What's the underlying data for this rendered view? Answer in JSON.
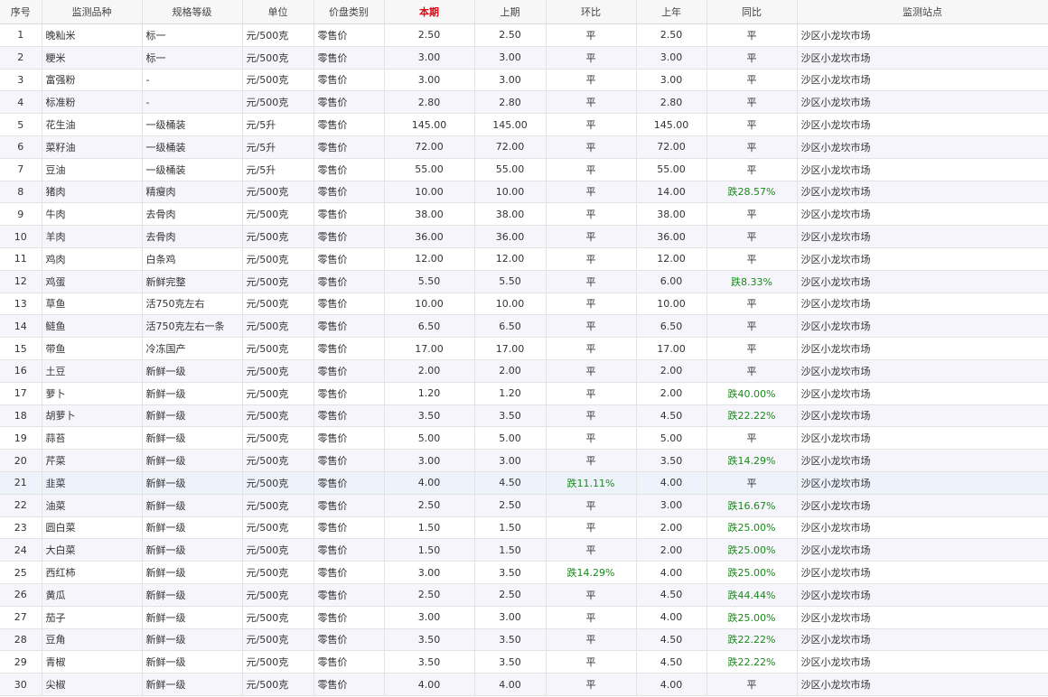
{
  "colors": {
    "current_period_header": "#e60012",
    "fall_text": "#1a8a1a",
    "even_row": "#f6f5fb",
    "header_bg": "#f7f7f7"
  },
  "columns": [
    {
      "key": "no",
      "label": "序号",
      "align": "c"
    },
    {
      "key": "item",
      "label": "监测品种",
      "align": "l"
    },
    {
      "key": "spec",
      "label": "规格等级",
      "align": "l"
    },
    {
      "key": "unit",
      "label": "单位",
      "align": "l"
    },
    {
      "key": "ptype",
      "label": "价盘类别",
      "align": "l"
    },
    {
      "key": "cur",
      "label": "本期",
      "align": "c",
      "highlight": true
    },
    {
      "key": "prev",
      "label": "上期",
      "align": "c"
    },
    {
      "key": "mom",
      "label": "环比",
      "align": "c"
    },
    {
      "key": "ly",
      "label": "上年",
      "align": "c"
    },
    {
      "key": "yoy",
      "label": "同比",
      "align": "c"
    },
    {
      "key": "site",
      "label": "监测站点",
      "align": "l"
    }
  ],
  "rows": [
    {
      "no": "1",
      "item": "晚籼米",
      "spec": "标一",
      "unit": "元/500克",
      "ptype": "零售价",
      "cur": "2.50",
      "prev": "2.50",
      "mom": "平",
      "ly": "2.50",
      "yoy": "平",
      "site": "沙区小龙坎市场"
    },
    {
      "no": "2",
      "item": "粳米",
      "spec": "标一",
      "unit": "元/500克",
      "ptype": "零售价",
      "cur": "3.00",
      "prev": "3.00",
      "mom": "平",
      "ly": "3.00",
      "yoy": "平",
      "site": "沙区小龙坎市场"
    },
    {
      "no": "3",
      "item": "富强粉",
      "spec": "-",
      "unit": "元/500克",
      "ptype": "零售价",
      "cur": "3.00",
      "prev": "3.00",
      "mom": "平",
      "ly": "3.00",
      "yoy": "平",
      "site": "沙区小龙坎市场"
    },
    {
      "no": "4",
      "item": "标准粉",
      "spec": "-",
      "unit": "元/500克",
      "ptype": "零售价",
      "cur": "2.80",
      "prev": "2.80",
      "mom": "平",
      "ly": "2.80",
      "yoy": "平",
      "site": "沙区小龙坎市场"
    },
    {
      "no": "5",
      "item": "花生油",
      "spec": "一级桶装",
      "unit": "元/5升",
      "ptype": "零售价",
      "cur": "145.00",
      "prev": "145.00",
      "mom": "平",
      "ly": "145.00",
      "yoy": "平",
      "site": "沙区小龙坎市场"
    },
    {
      "no": "6",
      "item": "菜籽油",
      "spec": "一级桶装",
      "unit": "元/5升",
      "ptype": "零售价",
      "cur": "72.00",
      "prev": "72.00",
      "mom": "平",
      "ly": "72.00",
      "yoy": "平",
      "site": "沙区小龙坎市场"
    },
    {
      "no": "7",
      "item": "豆油",
      "spec": "一级桶装",
      "unit": "元/5升",
      "ptype": "零售价",
      "cur": "55.00",
      "prev": "55.00",
      "mom": "平",
      "ly": "55.00",
      "yoy": "平",
      "site": "沙区小龙坎市场"
    },
    {
      "no": "8",
      "item": "猪肉",
      "spec": "精瘦肉",
      "unit": "元/500克",
      "ptype": "零售价",
      "cur": "10.00",
      "prev": "10.00",
      "mom": "平",
      "ly": "14.00",
      "yoy": "跌28.57%",
      "site": "沙区小龙坎市场"
    },
    {
      "no": "9",
      "item": "牛肉",
      "spec": "去骨肉",
      "unit": "元/500克",
      "ptype": "零售价",
      "cur": "38.00",
      "prev": "38.00",
      "mom": "平",
      "ly": "38.00",
      "yoy": "平",
      "site": "沙区小龙坎市场"
    },
    {
      "no": "10",
      "item": "羊肉",
      "spec": "去骨肉",
      "unit": "元/500克",
      "ptype": "零售价",
      "cur": "36.00",
      "prev": "36.00",
      "mom": "平",
      "ly": "36.00",
      "yoy": "平",
      "site": "沙区小龙坎市场"
    },
    {
      "no": "11",
      "item": "鸡肉",
      "spec": "白条鸡",
      "unit": "元/500克",
      "ptype": "零售价",
      "cur": "12.00",
      "prev": "12.00",
      "mom": "平",
      "ly": "12.00",
      "yoy": "平",
      "site": "沙区小龙坎市场"
    },
    {
      "no": "12",
      "item": "鸡蛋",
      "spec": "新鲜完整",
      "unit": "元/500克",
      "ptype": "零售价",
      "cur": "5.50",
      "prev": "5.50",
      "mom": "平",
      "ly": "6.00",
      "yoy": "跌8.33%",
      "site": "沙区小龙坎市场"
    },
    {
      "no": "13",
      "item": "草鱼",
      "spec": "活750克左右",
      "unit": "元/500克",
      "ptype": "零售价",
      "cur": "10.00",
      "prev": "10.00",
      "mom": "平",
      "ly": "10.00",
      "yoy": "平",
      "site": "沙区小龙坎市场"
    },
    {
      "no": "14",
      "item": "鲢鱼",
      "spec": "活750克左右一条",
      "unit": "元/500克",
      "ptype": "零售价",
      "cur": "6.50",
      "prev": "6.50",
      "mom": "平",
      "ly": "6.50",
      "yoy": "平",
      "site": "沙区小龙坎市场"
    },
    {
      "no": "15",
      "item": "带鱼",
      "spec": "冷冻国产",
      "unit": "元/500克",
      "ptype": "零售价",
      "cur": "17.00",
      "prev": "17.00",
      "mom": "平",
      "ly": "17.00",
      "yoy": "平",
      "site": "沙区小龙坎市场"
    },
    {
      "no": "16",
      "item": "土豆",
      "spec": "新鲜一级",
      "unit": "元/500克",
      "ptype": "零售价",
      "cur": "2.00",
      "prev": "2.00",
      "mom": "平",
      "ly": "2.00",
      "yoy": "平",
      "site": "沙区小龙坎市场"
    },
    {
      "no": "17",
      "item": "萝卜",
      "spec": "新鲜一级",
      "unit": "元/500克",
      "ptype": "零售价",
      "cur": "1.20",
      "prev": "1.20",
      "mom": "平",
      "ly": "2.00",
      "yoy": "跌40.00%",
      "site": "沙区小龙坎市场"
    },
    {
      "no": "18",
      "item": "胡萝卜",
      "spec": "新鲜一级",
      "unit": "元/500克",
      "ptype": "零售价",
      "cur": "3.50",
      "prev": "3.50",
      "mom": "平",
      "ly": "4.50",
      "yoy": "跌22.22%",
      "site": "沙区小龙坎市场"
    },
    {
      "no": "19",
      "item": "蒜苔",
      "spec": "新鲜一级",
      "unit": "元/500克",
      "ptype": "零售价",
      "cur": "5.00",
      "prev": "5.00",
      "mom": "平",
      "ly": "5.00",
      "yoy": "平",
      "site": "沙区小龙坎市场"
    },
    {
      "no": "20",
      "item": "芹菜",
      "spec": "新鲜一级",
      "unit": "元/500克",
      "ptype": "零售价",
      "cur": "3.00",
      "prev": "3.00",
      "mom": "平",
      "ly": "3.50",
      "yoy": "跌14.29%",
      "site": "沙区小龙坎市场"
    },
    {
      "no": "21",
      "item": "韭菜",
      "spec": "新鲜一级",
      "unit": "元/500克",
      "ptype": "零售价",
      "cur": "4.00",
      "prev": "4.50",
      "mom": "跌11.11%",
      "ly": "4.00",
      "yoy": "平",
      "site": "沙区小龙坎市场"
    },
    {
      "no": "22",
      "item": "油菜",
      "spec": "新鲜一级",
      "unit": "元/500克",
      "ptype": "零售价",
      "cur": "2.50",
      "prev": "2.50",
      "mom": "平",
      "ly": "3.00",
      "yoy": "跌16.67%",
      "site": "沙区小龙坎市场"
    },
    {
      "no": "23",
      "item": "圆白菜",
      "spec": "新鲜一级",
      "unit": "元/500克",
      "ptype": "零售价",
      "cur": "1.50",
      "prev": "1.50",
      "mom": "平",
      "ly": "2.00",
      "yoy": "跌25.00%",
      "site": "沙区小龙坎市场"
    },
    {
      "no": "24",
      "item": "大白菜",
      "spec": "新鲜一级",
      "unit": "元/500克",
      "ptype": "零售价",
      "cur": "1.50",
      "prev": "1.50",
      "mom": "平",
      "ly": "2.00",
      "yoy": "跌25.00%",
      "site": "沙区小龙坎市场"
    },
    {
      "no": "25",
      "item": "西红柿",
      "spec": "新鲜一级",
      "unit": "元/500克",
      "ptype": "零售价",
      "cur": "3.00",
      "prev": "3.50",
      "mom": "跌14.29%",
      "ly": "4.00",
      "yoy": "跌25.00%",
      "site": "沙区小龙坎市场"
    },
    {
      "no": "26",
      "item": "黄瓜",
      "spec": "新鲜一级",
      "unit": "元/500克",
      "ptype": "零售价",
      "cur": "2.50",
      "prev": "2.50",
      "mom": "平",
      "ly": "4.50",
      "yoy": "跌44.44%",
      "site": "沙区小龙坎市场"
    },
    {
      "no": "27",
      "item": "茄子",
      "spec": "新鲜一级",
      "unit": "元/500克",
      "ptype": "零售价",
      "cur": "3.00",
      "prev": "3.00",
      "mom": "平",
      "ly": "4.00",
      "yoy": "跌25.00%",
      "site": "沙区小龙坎市场"
    },
    {
      "no": "28",
      "item": "豆角",
      "spec": "新鲜一级",
      "unit": "元/500克",
      "ptype": "零售价",
      "cur": "3.50",
      "prev": "3.50",
      "mom": "平",
      "ly": "4.50",
      "yoy": "跌22.22%",
      "site": "沙区小龙坎市场"
    },
    {
      "no": "29",
      "item": "青椒",
      "spec": "新鲜一级",
      "unit": "元/500克",
      "ptype": "零售价",
      "cur": "3.50",
      "prev": "3.50",
      "mom": "平",
      "ly": "4.50",
      "yoy": "跌22.22%",
      "site": "沙区小龙坎市场"
    },
    {
      "no": "30",
      "item": "尖椒",
      "spec": "新鲜一级",
      "unit": "元/500克",
      "ptype": "零售价",
      "cur": "4.00",
      "prev": "4.00",
      "mom": "平",
      "ly": "4.00",
      "yoy": "平",
      "site": "沙区小龙坎市场"
    }
  ]
}
